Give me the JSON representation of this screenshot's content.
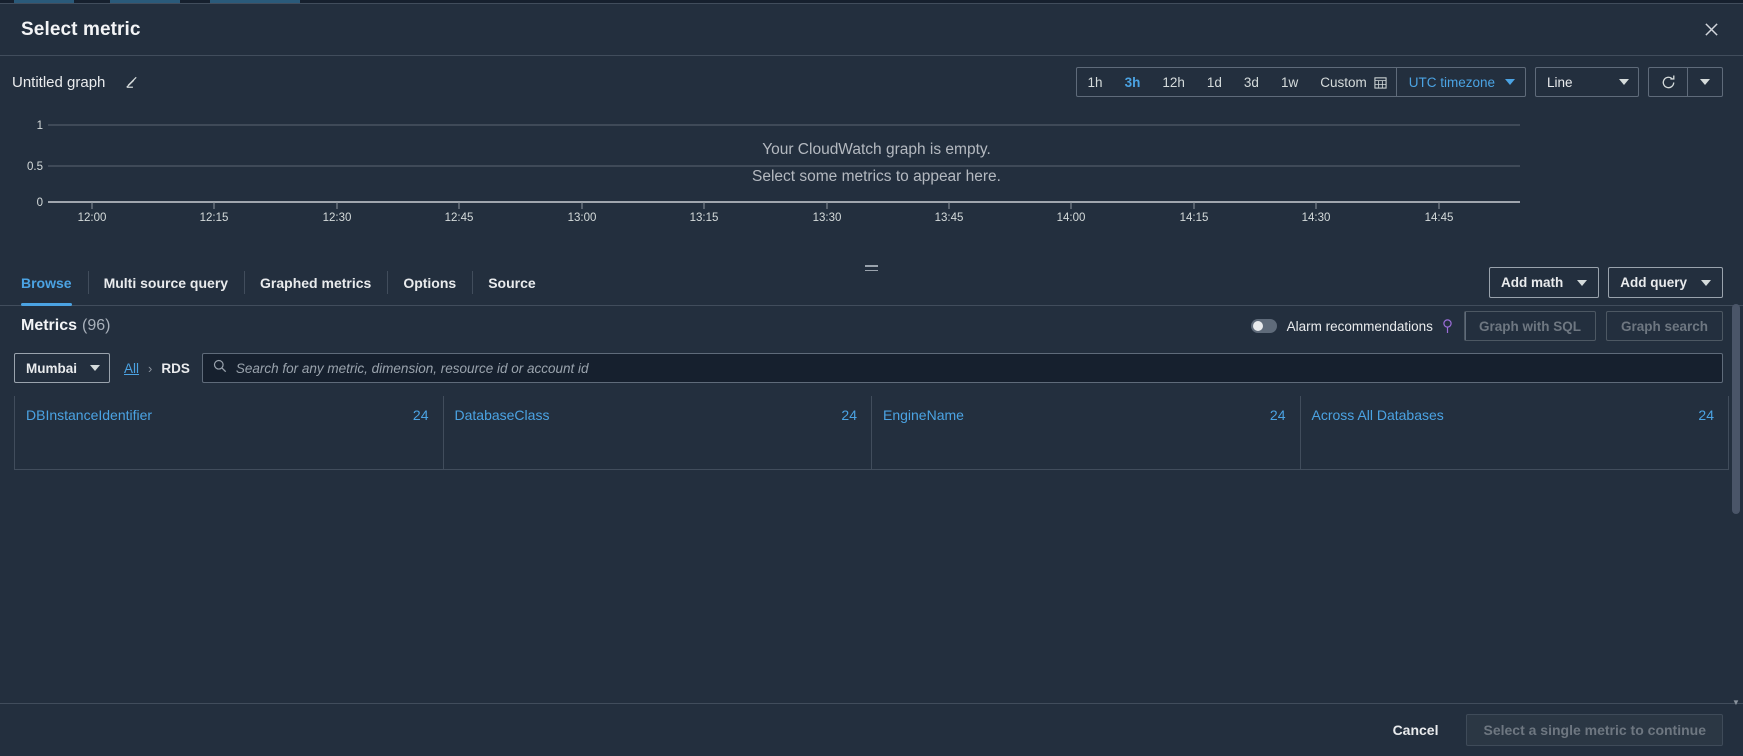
{
  "dialog": {
    "title": "Select metric",
    "close_icon": "close-icon"
  },
  "graph": {
    "name": "Untitled graph",
    "edit_icon": "pencil-icon",
    "empty_title": "Your CloudWatch graph is empty.",
    "empty_subtitle": "Select some metrics to appear here."
  },
  "toolbar": {
    "ranges": [
      {
        "label": "1h",
        "active": false
      },
      {
        "label": "3h",
        "active": true
      },
      {
        "label": "12h",
        "active": false
      },
      {
        "label": "1d",
        "active": false
      },
      {
        "label": "3d",
        "active": false
      },
      {
        "label": "1w",
        "active": false
      }
    ],
    "custom_label": "Custom",
    "custom_icon": "calendar-icon",
    "timezone": "UTC timezone",
    "chart_type": "Line",
    "refresh_icon": "refresh-icon",
    "refresh_options_icon": "chevron-down-icon"
  },
  "chart_data": {
    "type": "line",
    "title": "Untitled graph",
    "series": [],
    "x": [
      "12:00",
      "12:15",
      "12:30",
      "12:45",
      "13:00",
      "13:15",
      "13:30",
      "13:45",
      "14:00",
      "14:15",
      "14:30",
      "14:45"
    ],
    "xlabel": "",
    "ylabel": "",
    "yticks": [
      "0",
      "0.5",
      "1"
    ],
    "ylim": [
      0,
      1
    ],
    "grid": true,
    "legend": "none",
    "annotation": "Your CloudWatch graph is empty. Select some metrics to appear here."
  },
  "tabs": [
    {
      "label": "Browse",
      "active": true
    },
    {
      "label": "Multi source query",
      "active": false
    },
    {
      "label": "Graphed metrics",
      "active": false
    },
    {
      "label": "Options",
      "active": false
    },
    {
      "label": "Source",
      "active": false
    }
  ],
  "tab_actions": {
    "add_math": "Add math",
    "add_query": "Add query"
  },
  "metrics": {
    "title": "Metrics",
    "count": "(96)",
    "alarm_recommendations_label": "Alarm recommendations",
    "info_icon": "info-icon",
    "graph_with_sql": "Graph with SQL",
    "graph_search": "Graph search"
  },
  "search": {
    "region": "Mumbai",
    "breadcrumb_all": "All",
    "breadcrumb_separator": "›",
    "breadcrumb_current": "RDS",
    "search_icon": "search-icon",
    "placeholder": "Search for any metric, dimension, resource id or account id",
    "value": ""
  },
  "dimension_cards": [
    {
      "label": "DBInstanceIdentifier",
      "count": "24"
    },
    {
      "label": "DatabaseClass",
      "count": "24"
    },
    {
      "label": "EngineName",
      "count": "24"
    },
    {
      "label": "Across All Databases",
      "count": "24"
    }
  ],
  "footer": {
    "cancel": "Cancel",
    "confirm": "Select a single metric to continue"
  },
  "colors": {
    "accent": "#4ba3e3",
    "panel": "#232f3e",
    "border": "#414d5c"
  }
}
